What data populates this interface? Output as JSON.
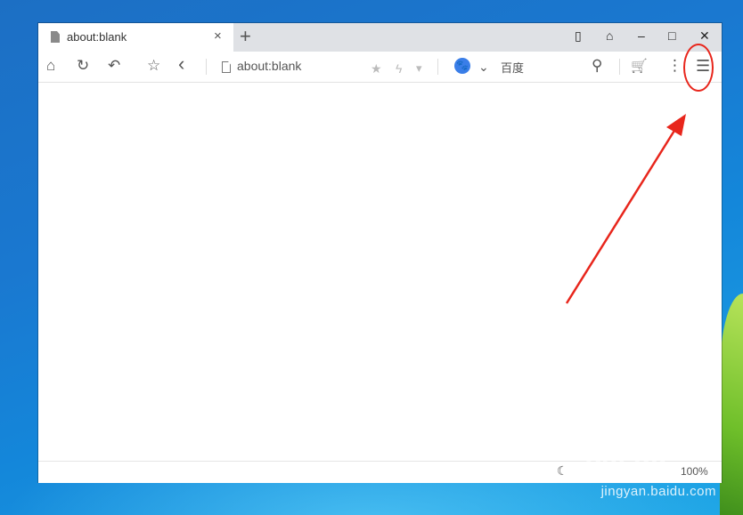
{
  "browser": {
    "tab": {
      "title": "about:blank",
      "close_glyph": "×"
    },
    "new_tab_glyph": "+",
    "window_controls": [
      "▯",
      "⌂",
      "–",
      "□",
      "✕"
    ],
    "toolbar": {
      "home_icon": "⌂",
      "refresh_icon": "↻",
      "undo_icon": "↶",
      "favorites_icon": "☆",
      "back_icon": "‹",
      "address": "about:blank",
      "address_star": "★",
      "address_bolt": "ϟ",
      "address_dropdown": "▾",
      "search_engine_logo": "🐾",
      "search_engine_chevron": "⌄",
      "search_engine_name": "百度",
      "search_icon": "⚲",
      "cart_icon": "🛒",
      "more_icon": "⋮",
      "menu_icon": "☰"
    },
    "status_bar": {
      "night_icon": "☾",
      "zoom_label": "100%"
    }
  },
  "watermark": {
    "logo_text": "Bai du",
    "site": "jingyan.baidu.com"
  },
  "colors": {
    "annotation": "#e8261c",
    "baidu_blue": "#3a7ee8"
  }
}
